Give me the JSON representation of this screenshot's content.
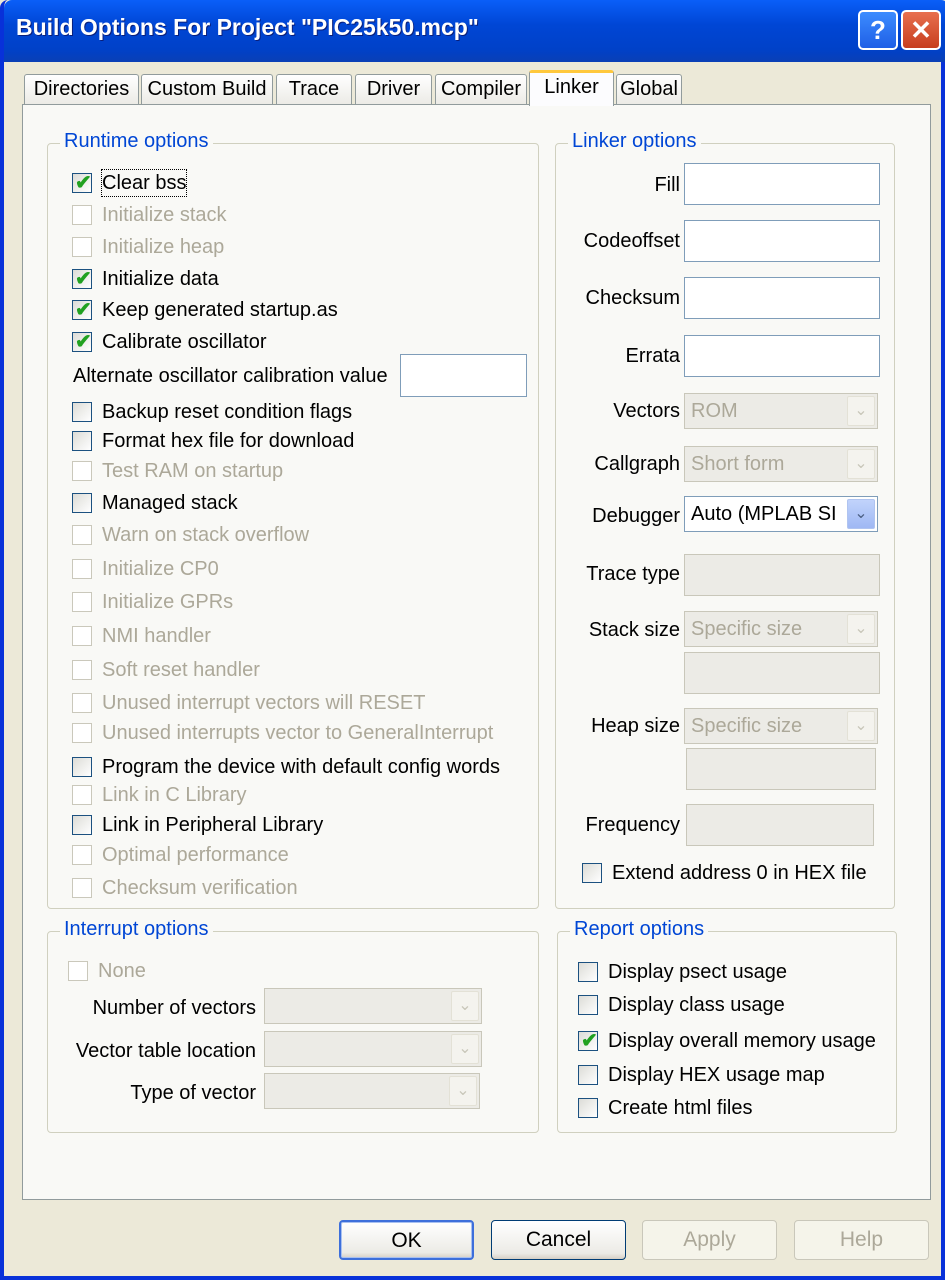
{
  "window": {
    "title": "Build Options For Project \"PIC25k50.mcp\"",
    "help_glyph": "?",
    "close_glyph": "✕"
  },
  "tabs": [
    "Directories",
    "Custom Build",
    "Trace",
    "Driver",
    "Compiler",
    "Linker",
    "Global"
  ],
  "active_tab": "Linker",
  "runtime": {
    "legend": "Runtime options",
    "clear_bss": "Clear bss",
    "initialize_stack": "Initialize stack",
    "initialize_heap": "Initialize heap",
    "initialize_data": "Initialize data",
    "keep_startup": "Keep generated startup.as",
    "calibrate_oscillator": "Calibrate oscillator",
    "alt_osc_label": "Alternate oscillator calibration value",
    "alt_osc_value": "",
    "backup_reset": "Backup reset condition flags",
    "format_hex": "Format hex file for download",
    "test_ram": "Test RAM on startup",
    "managed_stack": "Managed stack",
    "warn_stack": "Warn on stack overflow",
    "init_cp0": "Initialize CP0",
    "init_gprs": "Initialize GPRs",
    "nmi_handler": "NMI handler",
    "soft_reset": "Soft reset handler",
    "unused_reset": "Unused interrupt vectors will RESET",
    "unused_general": "Unused interrupts vector to GeneralInterrupt",
    "program_default": "Program the device with default config words",
    "link_c": "Link in C Library",
    "link_peripheral": "Link in Peripheral Library",
    "optimal": "Optimal performance",
    "checksum_verify": "Checksum verification"
  },
  "linker": {
    "legend": "Linker options",
    "fill": "Fill",
    "fill_value": "",
    "codeoffset": "Codeoffset",
    "codeoffset_value": "",
    "checksum": "Checksum",
    "checksum_value": "",
    "errata": "Errata",
    "errata_value": "",
    "vectors": "Vectors",
    "vectors_value": "ROM",
    "callgraph": "Callgraph",
    "callgraph_value": "Short form",
    "debugger": "Debugger",
    "debugger_value": "Auto (MPLAB SI",
    "trace_type": "Trace type",
    "stack_size": "Stack size",
    "stack_size_value": "Specific size",
    "heap_size": "Heap size",
    "heap_size_value": "Specific size",
    "frequency": "Frequency",
    "extend_address": "Extend address 0 in HEX file"
  },
  "interrupt": {
    "legend": "Interrupt options",
    "none": "None",
    "num_vectors": "Number of vectors",
    "vector_table": "Vector table location",
    "type_vector": "Type of vector"
  },
  "report": {
    "legend": "Report options",
    "psect": "Display psect usage",
    "class": "Display class usage",
    "overall": "Display overall memory usage",
    "hexmap": "Display HEX usage map",
    "html": "Create html files"
  },
  "glyphs": {
    "check": "✔",
    "arrow": "⌄"
  },
  "buttons": {
    "ok": "OK",
    "cancel": "Cancel",
    "apply": "Apply",
    "help": "Help"
  }
}
